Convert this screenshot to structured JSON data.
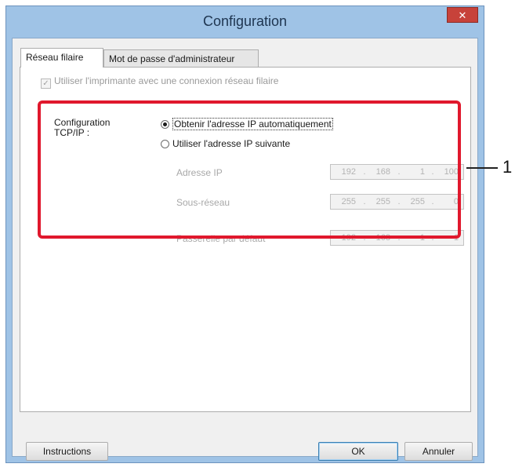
{
  "window": {
    "title": "Configuration",
    "close_glyph": "✕"
  },
  "tabs": [
    {
      "label": "Réseau filaire"
    },
    {
      "label": "Mot de passe d'administrateur"
    }
  ],
  "wired": {
    "checkbox_label": "Utiliser l'imprimante avec une connexion réseau filaire",
    "checkbox_checked": true,
    "checkbox_enabled": false,
    "tcpip_label_line1": "Configuration",
    "tcpip_label_line2": "TCP/IP :",
    "radio_auto": "Obtenir l'adresse IP automatiquement",
    "radio_manual": "Utiliser l'adresse IP suivante",
    "selected_option": "auto",
    "fields": [
      {
        "label": "Adresse IP",
        "octets": [
          "192",
          "168",
          "1",
          "100"
        ]
      },
      {
        "label": "Sous-réseau",
        "octets": [
          "255",
          "255",
          "255",
          "0"
        ]
      },
      {
        "label": "Passerelle par défaut",
        "octets": [
          "192",
          "168",
          "1",
          "1"
        ]
      }
    ]
  },
  "callout": {
    "number": "1",
    "color": "#e0182d"
  },
  "buttons": {
    "instructions": "Instructions",
    "ok": "OK",
    "cancel": "Annuler"
  }
}
